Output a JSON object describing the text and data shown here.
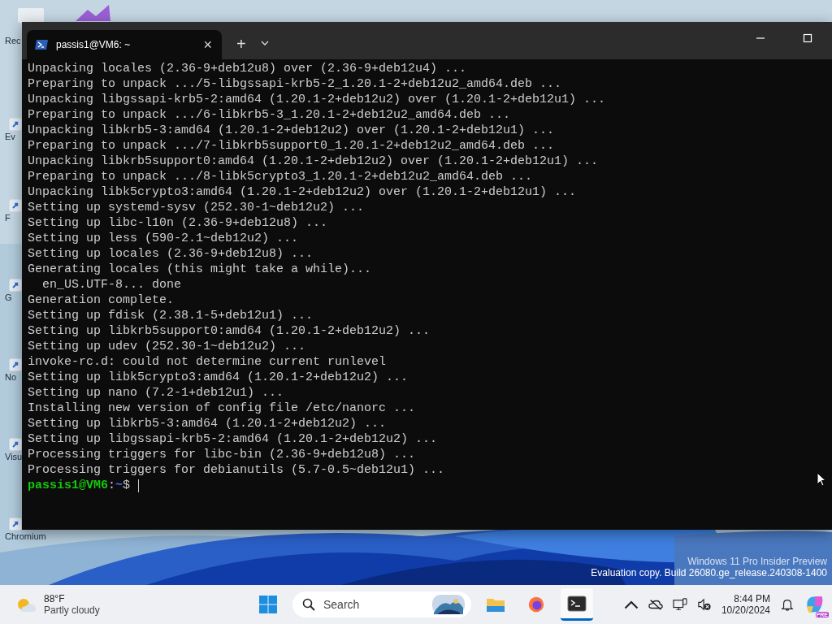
{
  "desktop": {
    "icons": [
      {
        "label": "Rec"
      },
      {
        "label": "Ev"
      },
      {
        "label": "F"
      },
      {
        "label": "G"
      },
      {
        "label": "No"
      },
      {
        "label": "Visu"
      },
      {
        "label": "Chromium"
      }
    ],
    "watermark": [
      "Windows 11 Pro Insider Preview",
      "Evaluation copy. Build 26080.ge_release.240308-1400"
    ]
  },
  "terminal": {
    "tab": {
      "title": "passis1@VM6: ~",
      "close": "×",
      "selected": true
    },
    "new_tab": "+",
    "lines": [
      "Unpacking locales (2.36-9+deb12u8) over (2.36-9+deb12u4) ...",
      "Preparing to unpack .../5-libgssapi-krb5-2_1.20.1-2+deb12u2_amd64.deb ...",
      "Unpacking libgssapi-krb5-2:amd64 (1.20.1-2+deb12u2) over (1.20.1-2+deb12u1) ...",
      "Preparing to unpack .../6-libkrb5-3_1.20.1-2+deb12u2_amd64.deb ...",
      "Unpacking libkrb5-3:amd64 (1.20.1-2+deb12u2) over (1.20.1-2+deb12u1) ...",
      "Preparing to unpack .../7-libkrb5support0_1.20.1-2+deb12u2_amd64.deb ...",
      "Unpacking libkrb5support0:amd64 (1.20.1-2+deb12u2) over (1.20.1-2+deb12u1) ...",
      "Preparing to unpack .../8-libk5crypto3_1.20.1-2+deb12u2_amd64.deb ...",
      "Unpacking libk5crypto3:amd64 (1.20.1-2+deb12u2) over (1.20.1-2+deb12u1) ...",
      "Setting up systemd-sysv (252.30-1~deb12u2) ...",
      "Setting up libc-l10n (2.36-9+deb12u8) ...",
      "Setting up less (590-2.1~deb12u2) ...",
      "Setting up locales (2.36-9+deb12u8) ...",
      "Generating locales (this might take a while)...",
      "  en_US.UTF-8... done",
      "Generation complete.",
      "Setting up fdisk (2.38.1-5+deb12u1) ...",
      "Setting up libkrb5support0:amd64 (1.20.1-2+deb12u2) ...",
      "Setting up udev (252.30-1~deb12u2) ...",
      "invoke-rc.d: could not determine current runlevel",
      "Setting up libk5crypto3:amd64 (1.20.1-2+deb12u2) ...",
      "Setting up nano (7.2-1+deb12u1) ...",
      "Installing new version of config file /etc/nanorc ...",
      "Setting up libkrb5-3:amd64 (1.20.1-2+deb12u2) ...",
      "Setting up libgssapi-krb5-2:amd64 (1.20.1-2+deb12u2) ...",
      "Processing triggers for libc-bin (2.36-9+deb12u8) ...",
      "Processing triggers for debianutils (5.7-0.5~deb12u1) ..."
    ],
    "prompt": {
      "user_host": "passis1@VM6",
      "separator": ":",
      "path": "~",
      "symbol": "$"
    }
  },
  "taskbar": {
    "weather": {
      "temperature": "88°F",
      "condition": "Partly cloudy"
    },
    "search": {
      "placeholder": "Search"
    },
    "apps": [
      {
        "kind": "explorer",
        "active": false
      },
      {
        "kind": "firefox",
        "active": false
      },
      {
        "kind": "terminal",
        "active": true
      }
    ],
    "clock": {
      "time": "8:44 PM",
      "date": "10/20/2024"
    },
    "copilot_badge": "PRE"
  }
}
